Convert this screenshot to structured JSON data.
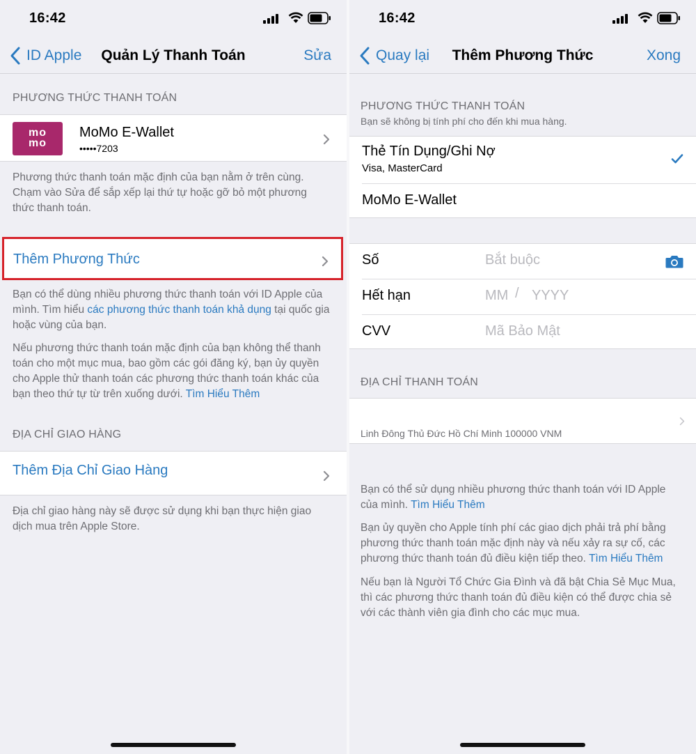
{
  "left": {
    "status": {
      "time": "16:42"
    },
    "nav": {
      "back_label": "ID Apple",
      "title": "Quản Lý Thanh Toán",
      "action_label": "Sửa"
    },
    "payment_header": "PHƯƠNG THỨC THANH TOÁN",
    "momo": {
      "logo_top": "mo",
      "logo_bottom": "mo",
      "name": "MoMo E-Wallet",
      "number": "•••••7203"
    },
    "payment_footer": "Phương thức thanh toán mặc định của bạn nằm ở trên cùng. Chạm vào Sửa để sắp xếp lại thứ tự hoặc gỡ bỏ một phương thức thanh toán.",
    "add_method_label": "Thêm Phương Thức",
    "info1_a": "Bạn có thể dùng nhiều phương thức thanh toán với ID Apple của mình. Tìm hiểu ",
    "info1_link": "các phương thức thanh toán khả dụng",
    "info1_b": " tại quốc gia hoặc vùng của bạn.",
    "info2_a": "Nếu phương thức thanh toán mặc định của bạn không thể thanh toán cho một mục mua, bao gồm các gói đăng ký, bạn ủy quyền cho Apple thử thanh toán các phương thức thanh toán khác của bạn theo thứ tự từ trên xuống dưới. ",
    "info2_link": "Tìm Hiểu Thêm",
    "shipping_header": "ĐỊA CHỈ GIAO HÀNG",
    "add_shipping_label": "Thêm Địa Chỉ Giao Hàng",
    "shipping_footer": "Địa chỉ giao hàng này sẽ được sử dụng khi bạn thực hiện giao dịch mua trên Apple Store."
  },
  "right": {
    "status": {
      "time": "16:42"
    },
    "nav": {
      "back_label": "Quay lại",
      "title": "Thêm Phương Thức",
      "action_label": "Xong"
    },
    "payment_header": "PHƯƠNG THỨC THANH TOÁN",
    "payment_sub": "Bạn sẽ không bị tính phí cho đến khi mua hàng.",
    "options": [
      {
        "label": "Thẻ Tín Dụng/Ghi Nợ",
        "sub": "Visa, MasterCard",
        "selected": true
      },
      {
        "label": "MoMo E-Wallet",
        "selected": false
      }
    ],
    "card_fields": {
      "number_label": "Số",
      "number_placeholder": "Bắt buộc",
      "expiry_label": "Hết hạn",
      "month_placeholder": "MM",
      "slash": "/",
      "year_placeholder": "YYYY",
      "cvv_label": "CVV",
      "cvv_placeholder": "Mã Bảo Mật"
    },
    "billing_header": "ĐỊA CHỈ THANH TOÁN",
    "billing_address": "Linh Đông Thủ Đức Hồ Chí Minh 100000 VNM",
    "foot1_a": "Bạn có thể sử dụng nhiều phương thức thanh toán với ID Apple của mình. ",
    "foot1_link": "Tìm Hiểu Thêm",
    "foot2_a": "Bạn ủy quyền cho Apple tính phí các giao dịch phải trả phí bằng phương thức thanh toán mặc định này và nếu xảy ra sự cố, các phương thức thanh toán đủ điều kiện tiếp theo. ",
    "foot2_link": "Tìm Hiểu Thêm",
    "foot3": "Nếu bạn là Người Tổ Chức Gia Đình và đã bật Chia Sẻ Mục Mua, thì các phương thức thanh toán đủ điều kiện có thể được chia sẻ với các thành viên gia đình cho các mục mua."
  },
  "colors": {
    "accent": "#2a7ac0",
    "momo": "#a8286b",
    "highlight": "#d6222a",
    "background": "#efeff4"
  },
  "icons": [
    "signal-icon",
    "wifi-icon",
    "battery-icon",
    "chevron-left-icon",
    "chevron-right-icon",
    "checkmark-icon",
    "camera-icon"
  ]
}
